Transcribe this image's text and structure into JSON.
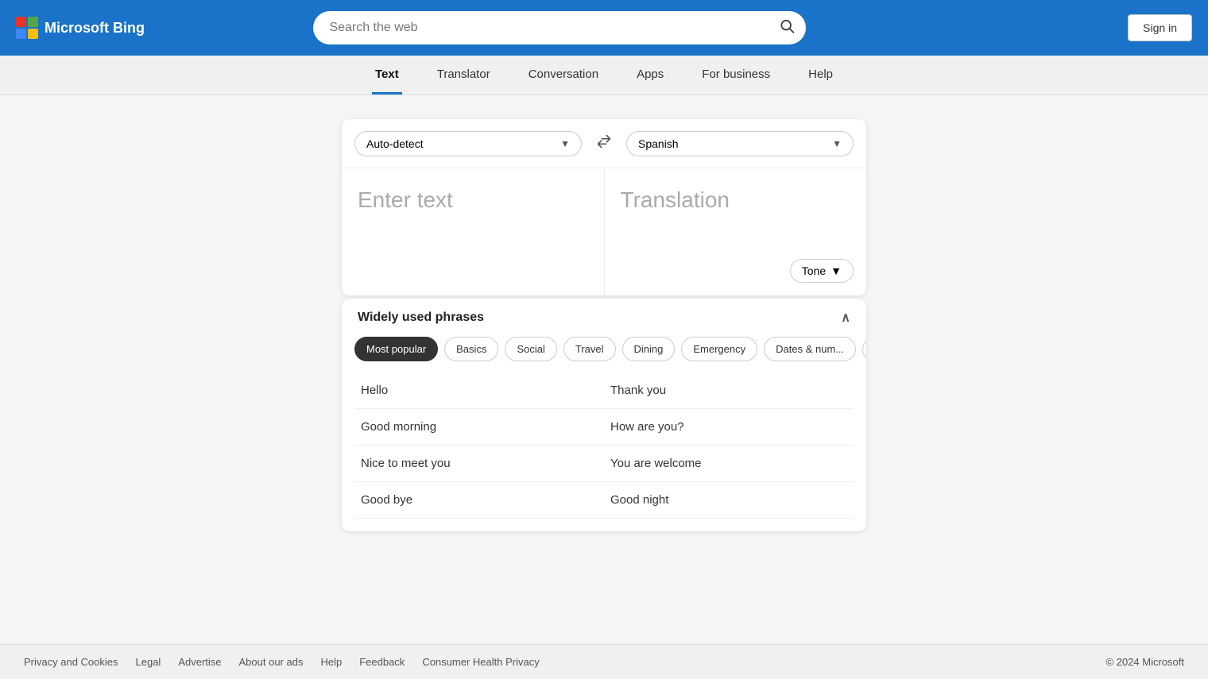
{
  "header": {
    "logo_text": "Microsoft Bing",
    "search_placeholder": "Search the web",
    "signin_label": "Sign in"
  },
  "nav": {
    "items": [
      {
        "label": "Text",
        "active": true
      },
      {
        "label": "Translator",
        "active": false
      },
      {
        "label": "Conversation",
        "active": false
      },
      {
        "label": "Apps",
        "active": false
      },
      {
        "label": "For business",
        "active": false
      },
      {
        "label": "Help",
        "active": false
      }
    ]
  },
  "translator": {
    "source_lang": "Auto-detect",
    "target_lang": "Spanish",
    "enter_text_placeholder": "Enter text",
    "translation_placeholder": "Translation",
    "tone_label": "Tone"
  },
  "phrases": {
    "section_title": "Widely used phrases",
    "categories": [
      {
        "label": "Most popular",
        "active": true
      },
      {
        "label": "Basics",
        "active": false
      },
      {
        "label": "Social",
        "active": false
      },
      {
        "label": "Travel",
        "active": false
      },
      {
        "label": "Dining",
        "active": false
      },
      {
        "label": "Emergency",
        "active": false
      },
      {
        "label": "Dates & num...",
        "active": false
      }
    ],
    "phrase_pairs": [
      {
        "left": "Hello",
        "right": "Thank you"
      },
      {
        "left": "Good morning",
        "right": "How are you?"
      },
      {
        "left": "Nice to meet you",
        "right": "You are welcome"
      },
      {
        "left": "Good bye",
        "right": "Good night"
      }
    ]
  },
  "footer": {
    "links": [
      "Privacy and Cookies",
      "Legal",
      "Advertise",
      "About our ads",
      "Help",
      "Feedback",
      "Consumer Health Privacy"
    ],
    "copyright": "© 2024 Microsoft"
  }
}
